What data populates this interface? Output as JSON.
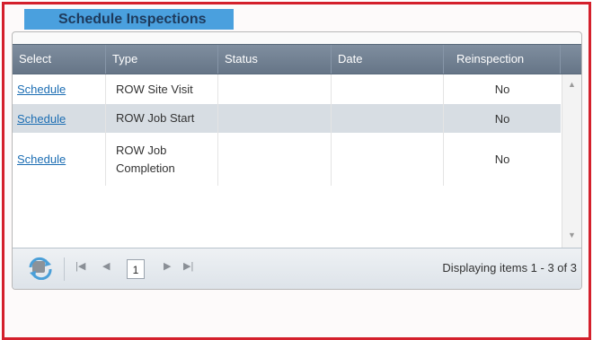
{
  "header": {
    "title": "Schedule Inspections"
  },
  "grid": {
    "columns": [
      "Select",
      "Type",
      "Status",
      "Date",
      "Reinspection"
    ],
    "rows": [
      {
        "select": "Schedule",
        "type": "ROW Site Visit",
        "status": "",
        "date": "",
        "reinspection": "No"
      },
      {
        "select": "Schedule",
        "type": "ROW Job Start",
        "status": "",
        "date": "",
        "reinspection": "No"
      },
      {
        "select": "Schedule",
        "type": "ROW Job Completion",
        "status": "",
        "date": "",
        "reinspection": "No"
      }
    ]
  },
  "pager": {
    "current_page": "1",
    "info": "Displaying items 1 - 3 of 3"
  },
  "colors": {
    "frame_border": "#d4202c",
    "tab_header": "#4aa0de",
    "grid_header": "#6f7e90",
    "alt_row": "#d7dde3",
    "link": "#1b6db3"
  },
  "icons": [
    "refresh-icon",
    "first-page-icon",
    "prev-page-icon",
    "next-page-icon",
    "last-page-icon",
    "scroll-up-icon",
    "scroll-down-icon"
  ]
}
